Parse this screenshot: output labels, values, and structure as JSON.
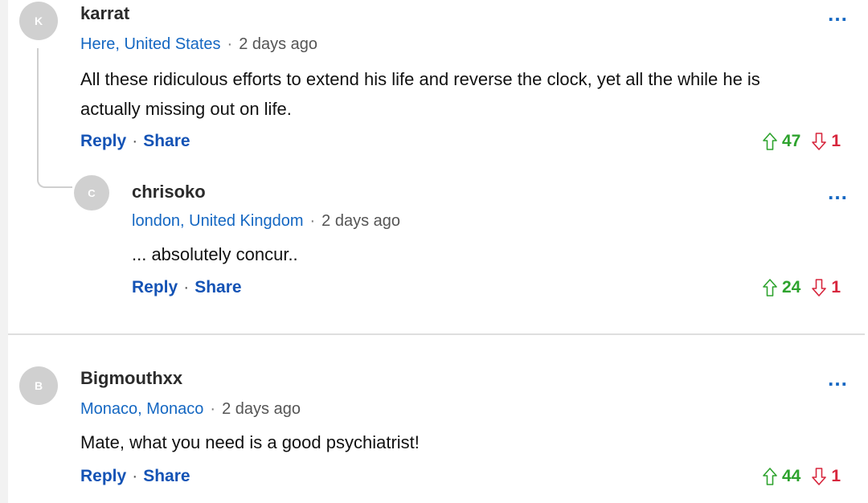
{
  "comments": [
    {
      "avatar_initial": "K",
      "username": "karrat",
      "location": "Here, United States",
      "time": "2 days ago",
      "text": "All these ridiculous efforts to extend his life and reverse the clock, yet all the while he is actually missing out on life.",
      "reply_label": "Reply",
      "share_label": "Share",
      "upvotes": "47",
      "downvotes": "1",
      "more_label": "…",
      "replies": [
        {
          "avatar_initial": "C",
          "username": "chrisoko",
          "location": "london, United Kingdom",
          "time": "2 days ago",
          "text": "... absolutely concur..",
          "reply_label": "Reply",
          "share_label": "Share",
          "upvotes": "24",
          "downvotes": "1",
          "more_label": "…"
        }
      ]
    },
    {
      "avatar_initial": "B",
      "username": "Bigmouthxx",
      "location": "Monaco, Monaco",
      "time": "2 days ago",
      "text": "Mate, what you need is a good psychiatrist!",
      "reply_label": "Reply",
      "share_label": "Share",
      "upvotes": "44",
      "downvotes": "1",
      "more_label": "…"
    }
  ],
  "separator": "·",
  "colors": {
    "upvote": "#2ea32e",
    "downvote": "#d7263d",
    "link": "#1453b5",
    "location": "#1467c2",
    "avatar": "#d0d0d0"
  },
  "icons": {
    "upvote": "arrow-up-outline-icon",
    "downvote": "arrow-down-outline-icon",
    "more": "ellipsis-icon"
  }
}
